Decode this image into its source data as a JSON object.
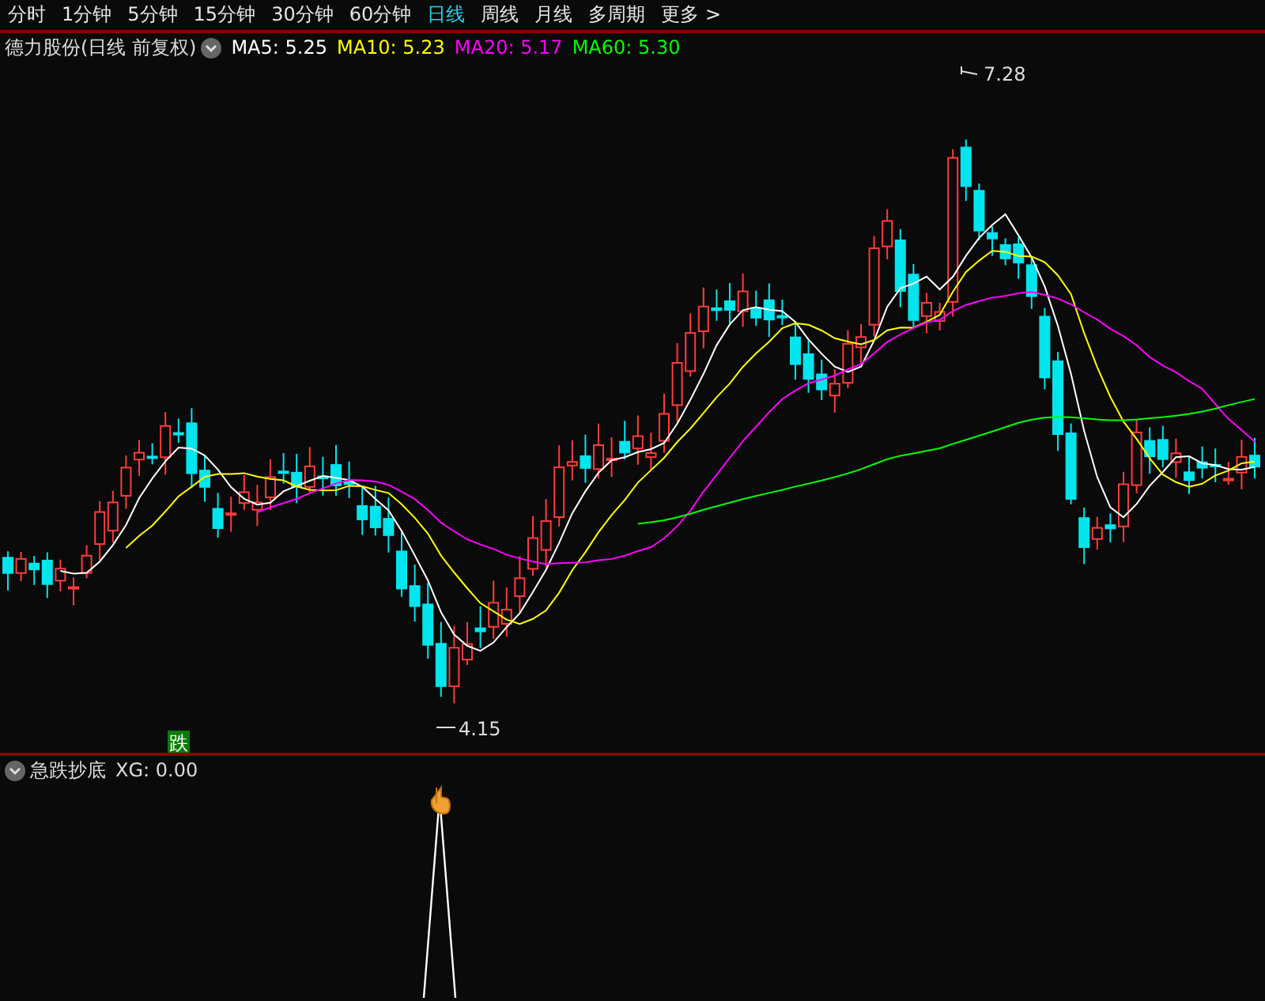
{
  "period_tabs": [
    {
      "label": "分时",
      "selected": false
    },
    {
      "label": "1分钟",
      "selected": false
    },
    {
      "label": "5分钟",
      "selected": false
    },
    {
      "label": "15分钟",
      "selected": false
    },
    {
      "label": "30分钟",
      "selected": false
    },
    {
      "label": "60分钟",
      "selected": false
    },
    {
      "label": "日线",
      "selected": true
    },
    {
      "label": "周线",
      "selected": false
    },
    {
      "label": "月线",
      "selected": false
    },
    {
      "label": "多周期",
      "selected": false
    },
    {
      "label": "更多 >",
      "selected": false
    }
  ],
  "main_chart": {
    "title": "德力股份(日线 前复权)",
    "moving_averages": [
      {
        "label": "MA5: 5.25",
        "color": "#ffffff"
      },
      {
        "label": "MA10: 5.23",
        "color": "#ffff00"
      },
      {
        "label": "MA20: 5.17",
        "color": "#ff00ff"
      },
      {
        "label": "MA60: 5.30",
        "color": "#00ff00"
      }
    ],
    "high_label": "7.28",
    "low_label": "4.15",
    "signal_badge": "跌"
  },
  "indicator_panel": {
    "title": "急跌抄底",
    "reading": "XG: 0.00"
  }
}
